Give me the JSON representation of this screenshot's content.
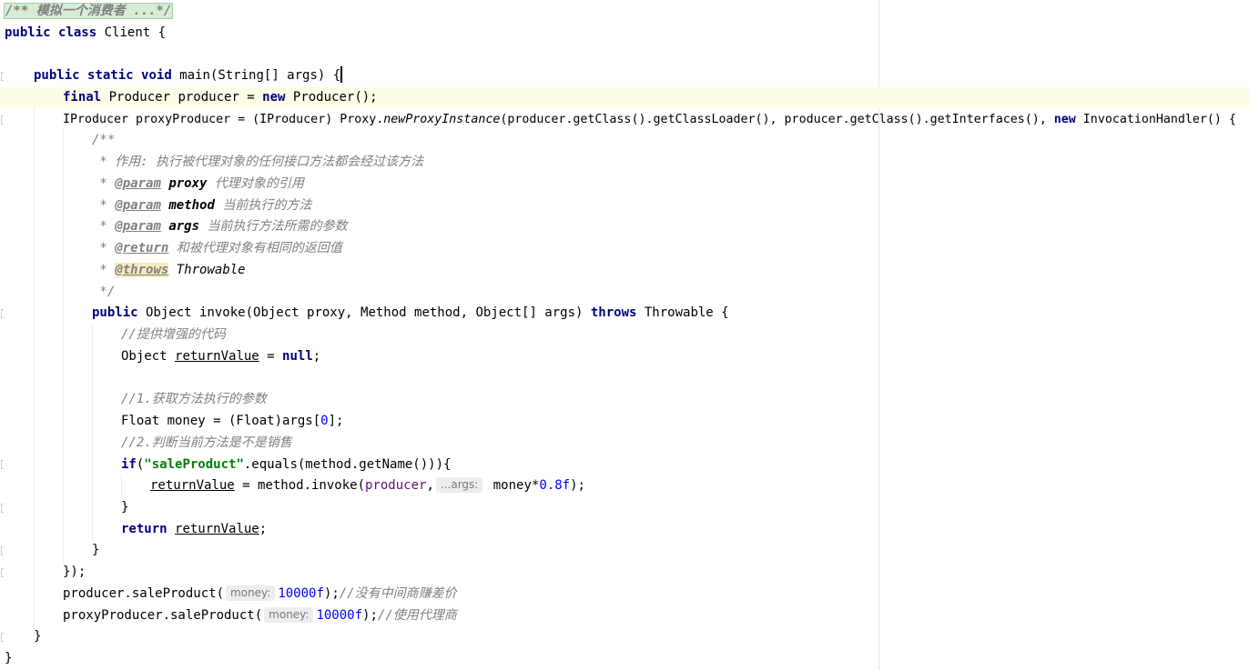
{
  "editor": {
    "lines": {
      "l1": {
        "folded_comment": "/** 模拟一个消费者 ...*/"
      },
      "l2": {
        "kw_public": "public",
        "kw_class": "class",
        "rest": " Client {"
      },
      "l4": {
        "kw_public": "public",
        "kw_static": "static",
        "kw_void": "void",
        "rest": " main(String[] args) {"
      },
      "l5": {
        "kw_final": "final",
        "mid": " Producer producer = ",
        "kw_new": "new",
        "rest": " Producer();"
      },
      "l6": {
        "pre": "IProducer proxyProducer = (IProducer) Proxy.",
        "static_call": "newProxyInstance",
        "mid": "(producer.getClass().getClassLoader(), producer.getClass().getInterfaces(), ",
        "kw_new": "new",
        "rest": " InvocationHandler() {"
      },
      "l7": {
        "text": "/**"
      },
      "l8": {
        "text": " * 作用: 执行被代理对象的任何接口方法都会经过该方法"
      },
      "l9": {
        "star": " * ",
        "tag": "@param",
        "name": "proxy",
        "desc": " 代理对象的引用"
      },
      "l10": {
        "star": " * ",
        "tag": "@param",
        "name": "method",
        "desc": " 当前执行的方法"
      },
      "l11": {
        "star": " * ",
        "tag": "@param",
        "name": "args",
        "desc": " 当前执行方法所需的参数"
      },
      "l12": {
        "star": " * ",
        "tag": "@return",
        "desc": " 和被代理对象有相同的返回值"
      },
      "l13": {
        "star": " * ",
        "tag": "@throws",
        "desc": " Throwable"
      },
      "l14": {
        "text": " */"
      },
      "l15": {
        "kw_public": "public",
        "mid": " Object invoke(Object proxy, Method method, Object[] args) ",
        "kw_throws": "throws",
        "rest": " Throwable {"
      },
      "l16": {
        "text": "//提供增强的代码"
      },
      "l17": {
        "pre": "Object ",
        "var": "returnValue",
        "mid": " = ",
        "kw_null": "null",
        "rest": ";"
      },
      "l19": {
        "text": "//1.获取方法执行的参数"
      },
      "l20": {
        "pre": "Float money = (Float)args[",
        "num": "0",
        "rest": "];"
      },
      "l21": {
        "text": "//2.判断当前方法是不是销售"
      },
      "l22": {
        "kw_if": "if",
        "pre": "(",
        "str": "\"saleProduct\"",
        "rest": ".equals(method.getName())){"
      },
      "l23": {
        "var": "returnValue",
        "mid": " = method.invoke(",
        "field": "producer",
        "sep": ",",
        "hint": "...args:",
        "arg": " money*",
        "num": "0.8f",
        "rest": ");"
      },
      "l24": {
        "text": "}"
      },
      "l25": {
        "kw_return": "return",
        "sp": " ",
        "var": "returnValue",
        "rest": ";"
      },
      "l26": {
        "text": "}"
      },
      "l27": {
        "text": "});"
      },
      "l28": {
        "pre": "producer.saleProduct(",
        "hint": "money:",
        "num": "10000f",
        "mid": ");",
        "comment": "//没有中间商赚差价"
      },
      "l29": {
        "pre": "proxyProducer.saleProduct(",
        "hint": "money:",
        "num": "10000f",
        "mid": ");",
        "comment": "//使用代理商"
      },
      "l30": {
        "text": "}"
      },
      "l31": {
        "text": "}"
      }
    }
  }
}
